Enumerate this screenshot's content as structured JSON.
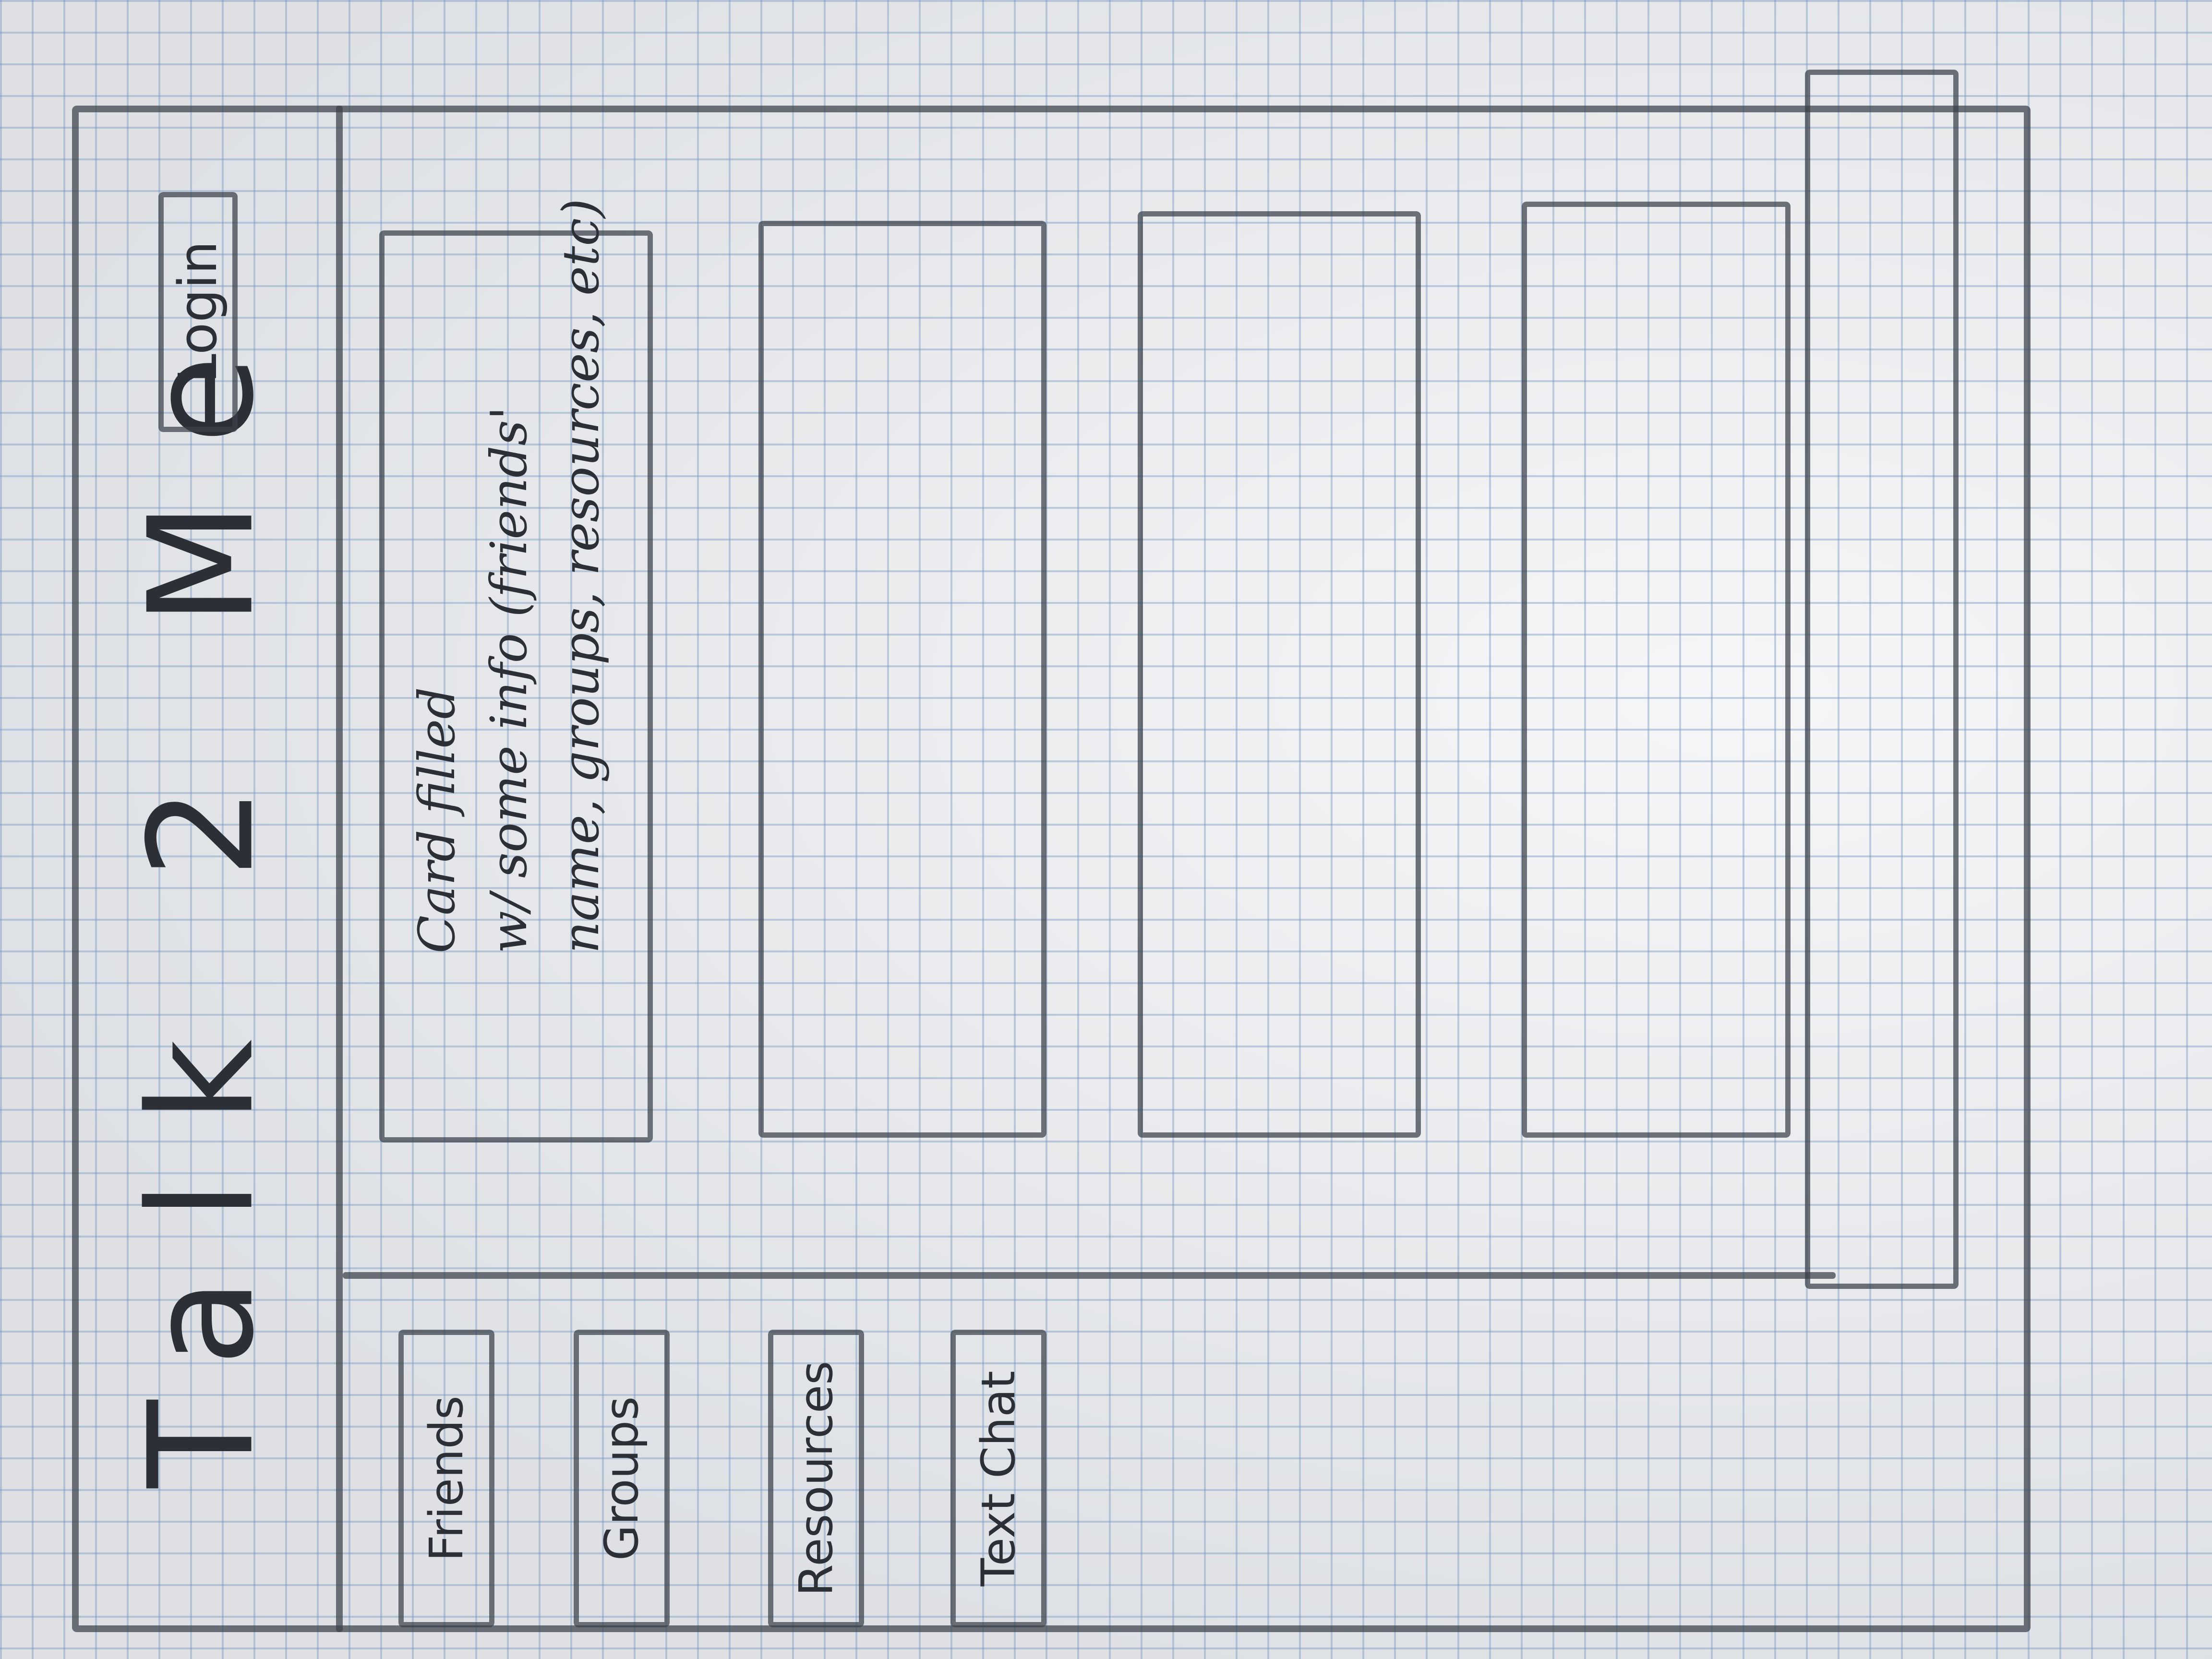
{
  "header": {
    "title": "Talk 2 Me",
    "login_label": "Login"
  },
  "nav": {
    "items": [
      {
        "label": "Friends"
      },
      {
        "label": "Groups"
      },
      {
        "label": "Resources"
      },
      {
        "label": "Text Chat"
      }
    ]
  },
  "cards": [
    {
      "note_lines": [
        "Card filled",
        "w/ some info (friends'",
        "name, groups, resources, etc)"
      ]
    },
    {
      "note_lines": []
    },
    {
      "note_lines": []
    },
    {
      "note_lines": []
    }
  ]
}
